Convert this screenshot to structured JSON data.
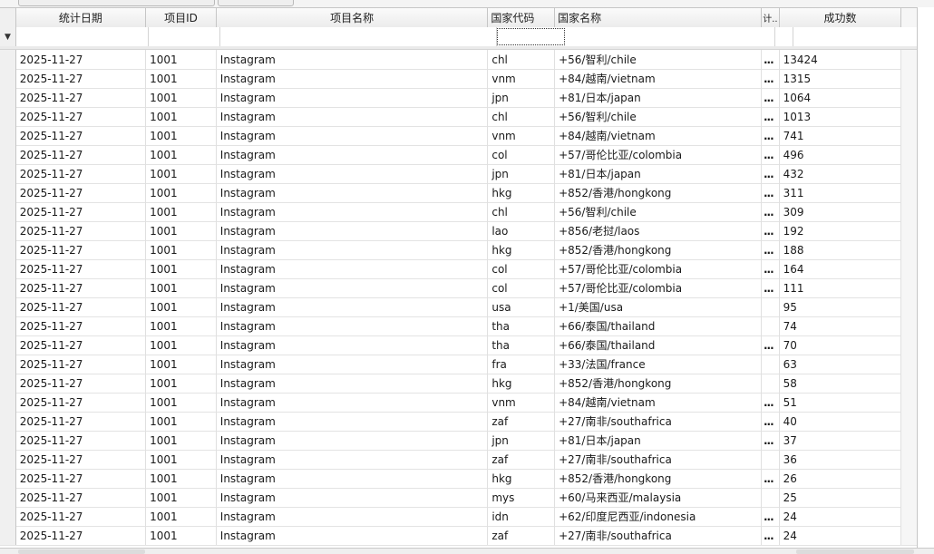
{
  "columns": {
    "date": "统计日期",
    "project_id": "项目ID",
    "project_name": "项目名称",
    "country_code": "国家代码",
    "country_name": "国家名称",
    "truncated": "计..",
    "success_count": "成功数"
  },
  "filter_row": {
    "indicator": "funnel-icon"
  },
  "ellipsis": "...",
  "rows": [
    {
      "date": "2025-11-27",
      "project_id": "1001",
      "project_name": "Instagram",
      "country_code": "chl",
      "country_name": "+56/智利/chile",
      "more": "...",
      "success": "13424"
    },
    {
      "date": "2025-11-27",
      "project_id": "1001",
      "project_name": "Instagram",
      "country_code": "vnm",
      "country_name": "+84/越南/vietnam",
      "more": "...",
      "success": "1315"
    },
    {
      "date": "2025-11-27",
      "project_id": "1001",
      "project_name": "Instagram",
      "country_code": "jpn",
      "country_name": "+81/日本/japan",
      "more": "...",
      "success": "1064"
    },
    {
      "date": "2025-11-27",
      "project_id": "1001",
      "project_name": "Instagram",
      "country_code": "chl",
      "country_name": "+56/智利/chile",
      "more": "...",
      "success": "1013"
    },
    {
      "date": "2025-11-27",
      "project_id": "1001",
      "project_name": "Instagram",
      "country_code": "vnm",
      "country_name": "+84/越南/vietnam",
      "more": "...",
      "success": "741"
    },
    {
      "date": "2025-11-27",
      "project_id": "1001",
      "project_name": "Instagram",
      "country_code": "col",
      "country_name": "+57/哥伦比亚/colombia",
      "more": "...",
      "success": "496"
    },
    {
      "date": "2025-11-27",
      "project_id": "1001",
      "project_name": "Instagram",
      "country_code": "jpn",
      "country_name": "+81/日本/japan",
      "more": "...",
      "success": "432"
    },
    {
      "date": "2025-11-27",
      "project_id": "1001",
      "project_name": "Instagram",
      "country_code": "hkg",
      "country_name": "+852/香港/hongkong",
      "more": "...",
      "success": "311"
    },
    {
      "date": "2025-11-27",
      "project_id": "1001",
      "project_name": "Instagram",
      "country_code": "chl",
      "country_name": "+56/智利/chile",
      "more": "...",
      "success": "309"
    },
    {
      "date": "2025-11-27",
      "project_id": "1001",
      "project_name": "Instagram",
      "country_code": "lao",
      "country_name": "+856/老挝/laos",
      "more": "...",
      "success": "192"
    },
    {
      "date": "2025-11-27",
      "project_id": "1001",
      "project_name": "Instagram",
      "country_code": "hkg",
      "country_name": "+852/香港/hongkong",
      "more": "...",
      "success": "188"
    },
    {
      "date": "2025-11-27",
      "project_id": "1001",
      "project_name": "Instagram",
      "country_code": "col",
      "country_name": "+57/哥伦比亚/colombia",
      "more": "...",
      "success": "164"
    },
    {
      "date": "2025-11-27",
      "project_id": "1001",
      "project_name": "Instagram",
      "country_code": "col",
      "country_name": "+57/哥伦比亚/colombia",
      "more": "...",
      "success": "111"
    },
    {
      "date": "2025-11-27",
      "project_id": "1001",
      "project_name": "Instagram",
      "country_code": "usa",
      "country_name": "+1/美国/usa",
      "more": "",
      "success": "95"
    },
    {
      "date": "2025-11-27",
      "project_id": "1001",
      "project_name": "Instagram",
      "country_code": "tha",
      "country_name": "+66/泰国/thailand",
      "more": "",
      "success": "74"
    },
    {
      "date": "2025-11-27",
      "project_id": "1001",
      "project_name": "Instagram",
      "country_code": "tha",
      "country_name": "+66/泰国/thailand",
      "more": "...",
      "success": "70"
    },
    {
      "date": "2025-11-27",
      "project_id": "1001",
      "project_name": "Instagram",
      "country_code": "fra",
      "country_name": "+33/法国/france",
      "more": "",
      "success": "63"
    },
    {
      "date": "2025-11-27",
      "project_id": "1001",
      "project_name": "Instagram",
      "country_code": "hkg",
      "country_name": "+852/香港/hongkong",
      "more": "",
      "success": "58"
    },
    {
      "date": "2025-11-27",
      "project_id": "1001",
      "project_name": "Instagram",
      "country_code": "vnm",
      "country_name": "+84/越南/vietnam",
      "more": "...",
      "success": "51"
    },
    {
      "date": "2025-11-27",
      "project_id": "1001",
      "project_name": "Instagram",
      "country_code": "zaf",
      "country_name": "+27/南非/southafrica",
      "more": "...",
      "success": "40"
    },
    {
      "date": "2025-11-27",
      "project_id": "1001",
      "project_name": "Instagram",
      "country_code": "jpn",
      "country_name": "+81/日本/japan",
      "more": "...",
      "success": "37"
    },
    {
      "date": "2025-11-27",
      "project_id": "1001",
      "project_name": "Instagram",
      "country_code": "zaf",
      "country_name": "+27/南非/southafrica",
      "more": "",
      "success": "36"
    },
    {
      "date": "2025-11-27",
      "project_id": "1001",
      "project_name": "Instagram",
      "country_code": "hkg",
      "country_name": "+852/香港/hongkong",
      "more": "...",
      "success": "26"
    },
    {
      "date": "2025-11-27",
      "project_id": "1001",
      "project_name": "Instagram",
      "country_code": "mys",
      "country_name": "+60/马来西亚/malaysia",
      "more": "",
      "success": "25"
    },
    {
      "date": "2025-11-27",
      "project_id": "1001",
      "project_name": "Instagram",
      "country_code": "idn",
      "country_name": "+62/印度尼西亚/indonesia",
      "more": "...",
      "success": "24"
    },
    {
      "date": "2025-11-27",
      "project_id": "1001",
      "project_name": "Instagram",
      "country_code": "zaf",
      "country_name": "+27/南非/southafrica",
      "more": "...",
      "success": "24"
    }
  ]
}
